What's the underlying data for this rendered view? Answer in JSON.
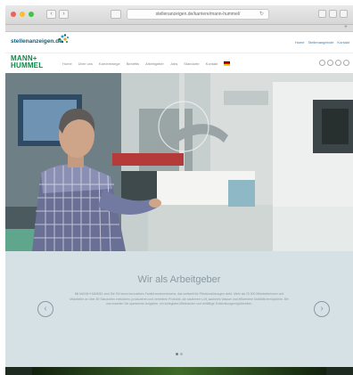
{
  "browser": {
    "url": "stellenanzeigen.de/karriere/mann-hummel/",
    "reload_icon": "reload-icon"
  },
  "site": {
    "logo_text": "stellenanzeigen.de",
    "logo_tagline": "",
    "top_links": [
      "Home",
      "Stellenangebote",
      "Kontakt"
    ]
  },
  "brand": {
    "name_line1": "MANN+",
    "name_line2": "HUMMEL",
    "nav_items": [
      "Home",
      "Über uns",
      "Karrierewege",
      "Benefits",
      "Arbeitgeber",
      "Jobs",
      "Standorte",
      "Kontakt"
    ],
    "flag_colors": [
      "#000000",
      "#dd0000",
      "#ffce00"
    ]
  },
  "employer": {
    "title": "Wir als Arbeitgeber",
    "text": "Mit MANN+HUMMEL sind Sie Teil eines innovativen Familienunternehmens, das weltweit für Filtrationslösungen steht. Mehr als 20.000 Mitarbeiterinnen und Mitarbeiter an über 80 Standorten entwickeln, produzieren und vertreiben Produkte, die sauberere Luft, sauberes Wasser und effizientere Mobilität ermöglichen. Bei uns erwarten Sie spannende Aufgaben, ein kollegiales Miteinander und vielfältige Entwicklungsmöglichkeiten.",
    "prev_label": "‹",
    "next_label": "›",
    "slide_count": 2,
    "active_slide": 0
  },
  "colors": {
    "brand_green": "#0c8a46",
    "section_bg": "#d5e1e4",
    "title_color": "#8b9aa0"
  }
}
